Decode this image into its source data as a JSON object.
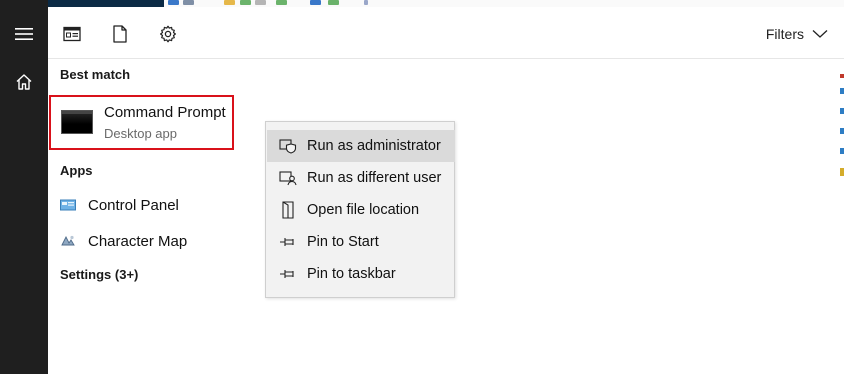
{
  "toolbar": {
    "filters_label": "Filters",
    "icons": [
      "apps-icon",
      "document-icon",
      "settings-icon"
    ]
  },
  "rail": {
    "icons": [
      "hamburger-menu-icon",
      "home-icon"
    ]
  },
  "sections": {
    "best_match": "Best match",
    "apps": "Apps",
    "settings": "Settings (3+)"
  },
  "best_match": {
    "title": "Command Prompt",
    "subtitle": "Desktop app"
  },
  "apps": [
    {
      "label": "Control Panel",
      "icon": "control-panel-icon"
    },
    {
      "label": "Character Map",
      "icon": "character-map-icon"
    }
  ],
  "context_menu": {
    "items": [
      {
        "label": "Run as administrator",
        "icon": "shield-window-icon",
        "highlighted": true
      },
      {
        "label": "Run as different user",
        "icon": "user-window-icon"
      },
      {
        "label": "Open file location",
        "icon": "file-location-icon"
      },
      {
        "label": "Pin to Start",
        "icon": "pin-icon"
      },
      {
        "label": "Pin to taskbar",
        "icon": "pin-icon"
      }
    ]
  },
  "colors": {
    "rail": "#1f1f1f",
    "highlight_border": "#d9111a",
    "menu_bg": "#f2f2f2",
    "menu_hover": "#dadada"
  }
}
